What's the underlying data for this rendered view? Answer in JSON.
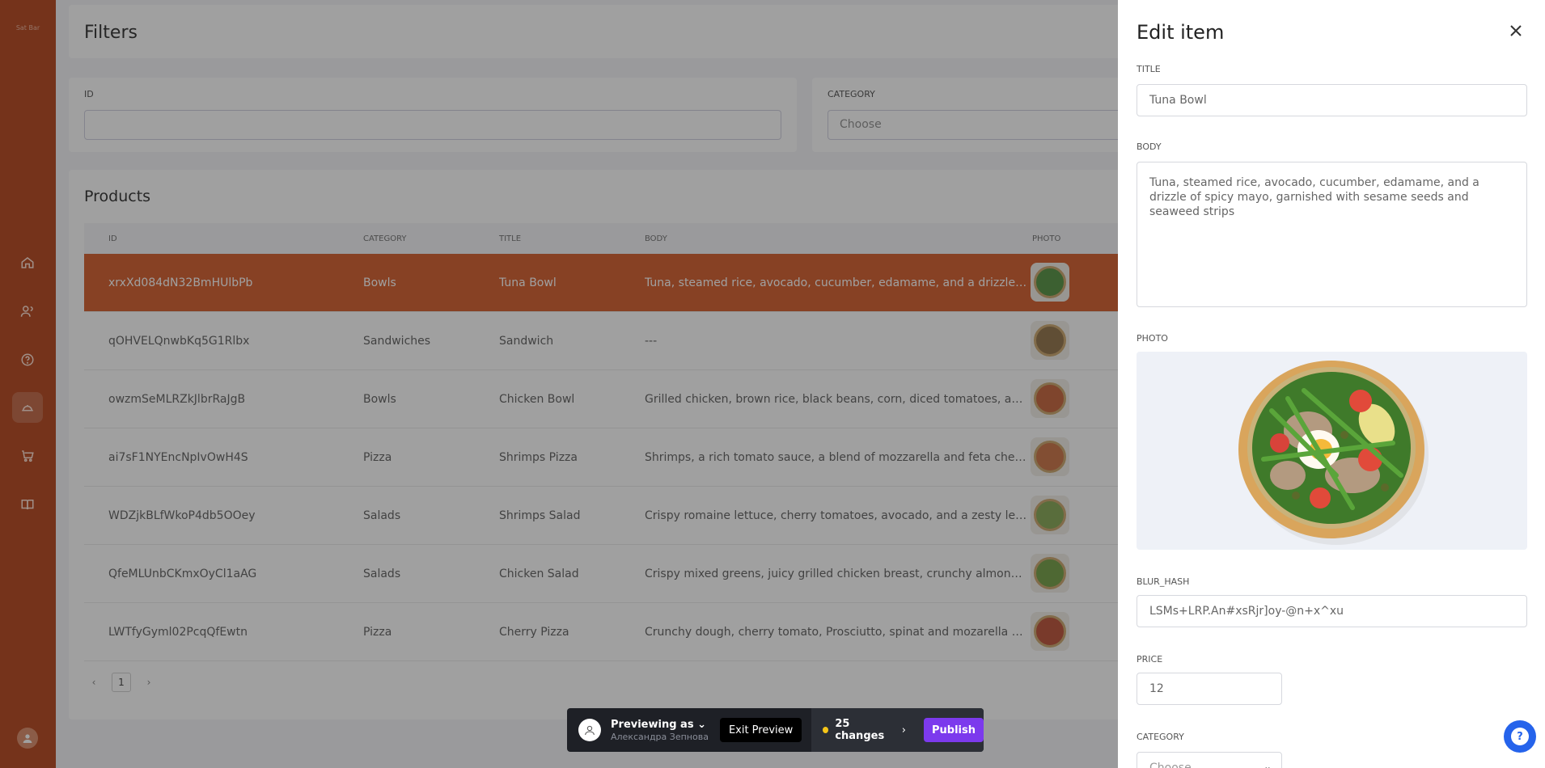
{
  "sidebar": {
    "logo_text": "Sat Bar",
    "items": [
      {
        "name": "home-icon",
        "active": false
      },
      {
        "name": "users-icon",
        "active": false
      },
      {
        "name": "help-circle-icon",
        "active": false
      },
      {
        "name": "dish-icon",
        "active": true
      },
      {
        "name": "cart-icon",
        "active": false
      },
      {
        "name": "book-icon",
        "active": false
      }
    ]
  },
  "filters": {
    "title": "Filters",
    "id_label": "ID",
    "id_value": "",
    "category_label": "CATEGORY",
    "category_placeholder": "Choose"
  },
  "products": {
    "title": "Products",
    "columns": [
      "ID",
      "CATEGORY",
      "TITLE",
      "BODY",
      "PHOTO"
    ],
    "rows": [
      {
        "id": "xrxXd084dN32BmHUlbPb",
        "category": "Bowls",
        "title": "Tuna Bowl",
        "body": "Tuna, steamed rice, avocado, cucumber, edamame, and a drizzle of spicy mayo",
        "selected": true
      },
      {
        "id": "qOHVELQnwbKq5G1Rlbx",
        "category": "Sandwiches",
        "title": "Sandwich",
        "body": "---",
        "selected": false
      },
      {
        "id": "owzmSeMLRZkJlbrRaJgB",
        "category": "Bowls",
        "title": "Chicken Bowl",
        "body": "Grilled chicken, brown rice, black beans, corn, diced tomatoes, and a sprinkle",
        "selected": false
      },
      {
        "id": "ai7sF1NYEncNpIvOwH4S",
        "category": "Pizza",
        "title": "Shrimps Pizza",
        "body": "Shrimps, a rich tomato sauce, a blend of mozzarella and feta cheeses, sliced",
        "selected": false
      },
      {
        "id": "WDZjkBLfWkoP4db5OOey",
        "category": "Salads",
        "title": "Shrimps Salad",
        "body": "Crispy romaine lettuce, cherry tomatoes, avocado, and a zesty lemon dressing",
        "selected": false
      },
      {
        "id": "QfeMLUnbCKmxOyCl1aAG",
        "category": "Salads",
        "title": "Chicken Salad",
        "body": "Crispy mixed greens, juicy grilled chicken breast, crunchy almonds, sweet",
        "selected": false
      },
      {
        "id": "LWTfyGyml02PcqQfEwtn",
        "category": "Pizza",
        "title": "Cherry Pizza",
        "body": "Crunchy dough, cherry tomato, Prosciutto, spinat and mozarella cheese",
        "selected": false
      }
    ],
    "pagination": {
      "prev": "‹",
      "current": "1",
      "next": "›"
    }
  },
  "preview_bar": {
    "title": "Previewing as",
    "user": "Александра Зепнова",
    "exit_label": "Exit Preview",
    "changes_label": "25 changes",
    "publish_label": "Publish"
  },
  "drawer": {
    "title": "Edit item",
    "title_label": "TITLE",
    "title_value": "Tuna Bowl",
    "body_label": "BODY",
    "body_value": "Tuna, steamed rice, avocado, cucumber, edamame, and a drizzle of spicy mayo, garnished with sesame seeds and seaweed strips",
    "photo_label": "PHOTO",
    "blur_hash_label": "BLUR_HASH",
    "blur_hash_value": "LSMs+LRP.An#xsRjr]oy-@n+x^xu",
    "price_label": "PRICE",
    "price_value": "12",
    "category_label": "CATEGORY",
    "category_placeholder": "Choose"
  },
  "colors": {
    "sidebar": "#b13a0e",
    "selected_row": "#d2521e",
    "publish": "#7c3aed",
    "help": "#2563eb"
  }
}
